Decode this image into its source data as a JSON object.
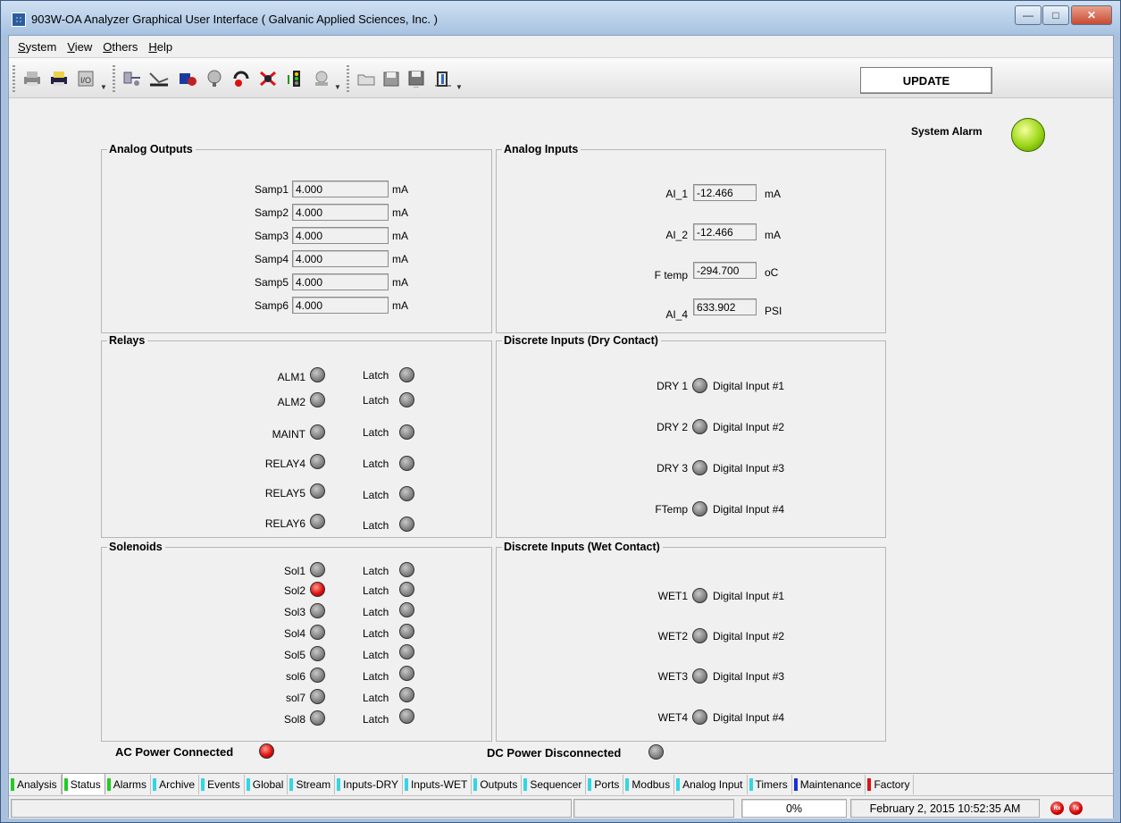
{
  "window": {
    "title": "903W-OA Analyzer Graphical User Interface  ( Galvanic Applied Sciences, Inc. )"
  },
  "menu": [
    {
      "underline": "S",
      "rest": "ystem"
    },
    {
      "underline": "V",
      "rest": "iew"
    },
    {
      "underline": "O",
      "rest": "thers"
    },
    {
      "underline": "H",
      "rest": "elp"
    }
  ],
  "toolbar": {
    "update_label": "UPDATE"
  },
  "system_alarm": {
    "label": "System Alarm",
    "state": "green"
  },
  "analog_outputs": {
    "title": "Analog Outputs",
    "rows": [
      {
        "label": "Samp1",
        "value": "4.000",
        "unit": "mA"
      },
      {
        "label": "Samp2",
        "value": "4.000",
        "unit": "mA"
      },
      {
        "label": "Samp3",
        "value": "4.000",
        "unit": "mA"
      },
      {
        "label": "Samp4",
        "value": "4.000",
        "unit": "mA"
      },
      {
        "label": "Samp5",
        "value": "4.000",
        "unit": "mA"
      },
      {
        "label": "Samp6",
        "value": "4.000",
        "unit": "mA"
      }
    ]
  },
  "analog_inputs": {
    "title": "Analog Inputs",
    "rows": [
      {
        "label": "AI_1",
        "value": "-12.466",
        "unit": "mA"
      },
      {
        "label": "AI_2",
        "value": "-12.466",
        "unit": "mA"
      },
      {
        "label": "F temp",
        "value": "-294.700",
        "unit": "oC"
      },
      {
        "label": "AI_4",
        "value": "633.902",
        "unit": "PSI"
      }
    ]
  },
  "relays": {
    "title": "Relays",
    "latch_label": "Latch",
    "rows": [
      {
        "label": "ALM1",
        "state": "off",
        "latch": "off"
      },
      {
        "label": "ALM2",
        "state": "off",
        "latch": "off"
      },
      {
        "label": "MAINT",
        "state": "off",
        "latch": "off"
      },
      {
        "label": "RELAY4",
        "state": "off",
        "latch": "off"
      },
      {
        "label": "RELAY5",
        "state": "off",
        "latch": "off"
      },
      {
        "label": "RELAY6",
        "state": "off",
        "latch": "off"
      }
    ]
  },
  "dry_inputs": {
    "title": "Discrete Inputs (Dry Contact)",
    "rows": [
      {
        "label": "DRY 1",
        "desc": "Digital Input #1",
        "state": "off"
      },
      {
        "label": "DRY 2",
        "desc": "Digital Input #2",
        "state": "off"
      },
      {
        "label": "DRY 3",
        "desc": "Digital Input #3",
        "state": "off"
      },
      {
        "label": "FTemp",
        "desc": "Digital Input #4",
        "state": "off"
      }
    ]
  },
  "solenoids": {
    "title": "Solenoids",
    "latch_label": "Latch",
    "rows": [
      {
        "label": "Sol1",
        "state": "off",
        "latch": "off"
      },
      {
        "label": "Sol2",
        "state": "red",
        "latch": "off"
      },
      {
        "label": "Sol3",
        "state": "off",
        "latch": "off"
      },
      {
        "label": "Sol4",
        "state": "off",
        "latch": "off"
      },
      {
        "label": "Sol5",
        "state": "off",
        "latch": "off"
      },
      {
        "label": "sol6",
        "state": "off",
        "latch": "off"
      },
      {
        "label": "sol7",
        "state": "off",
        "latch": "off"
      },
      {
        "label": "Sol8",
        "state": "off",
        "latch": "off"
      }
    ]
  },
  "wet_inputs": {
    "title": "Discrete Inputs (Wet Contact)",
    "rows": [
      {
        "label": "WET1",
        "desc": "Digital Input #1",
        "state": "off"
      },
      {
        "label": "WET2",
        "desc": "Digital Input #2",
        "state": "off"
      },
      {
        "label": "WET3",
        "desc": "Digital Input #3",
        "state": "off"
      },
      {
        "label": "WET4",
        "desc": "Digital Input #4",
        "state": "off"
      }
    ]
  },
  "power": {
    "ac_label": "AC Power Connected",
    "ac_state": "red",
    "dc_label": "DC Power Disconnected",
    "dc_state": "off"
  },
  "tabs": [
    {
      "label": "Analysis",
      "color": "#22cc22"
    },
    {
      "label": "Status",
      "color": "#22cc22",
      "active": true
    },
    {
      "label": "Alarms",
      "color": "#22cc22"
    },
    {
      "label": "Archive",
      "color": "#33d6e6"
    },
    {
      "label": "Events",
      "color": "#33d6e6"
    },
    {
      "label": "Global",
      "color": "#33d6e6"
    },
    {
      "label": "Stream",
      "color": "#33d6e6"
    },
    {
      "label": "Inputs-DRY",
      "color": "#33d6e6"
    },
    {
      "label": "Inputs-WET",
      "color": "#33d6e6"
    },
    {
      "label": "Outputs",
      "color": "#33d6e6"
    },
    {
      "label": "Sequencer",
      "color": "#33d6e6"
    },
    {
      "label": "Ports",
      "color": "#33d6e6"
    },
    {
      "label": "Modbus",
      "color": "#33d6e6"
    },
    {
      "label": "Analog Input",
      "color": "#33d6e6"
    },
    {
      "label": "Timers",
      "color": "#33d6e6"
    },
    {
      "label": "Maintenance",
      "color": "#1a2fd6"
    },
    {
      "label": "Factory",
      "color": "#e01010"
    }
  ],
  "status": {
    "progress": "0%",
    "datetime": "February 2, 2015 10:52:35 AM",
    "rx_label": "Rx",
    "tx_label": "Tx"
  }
}
